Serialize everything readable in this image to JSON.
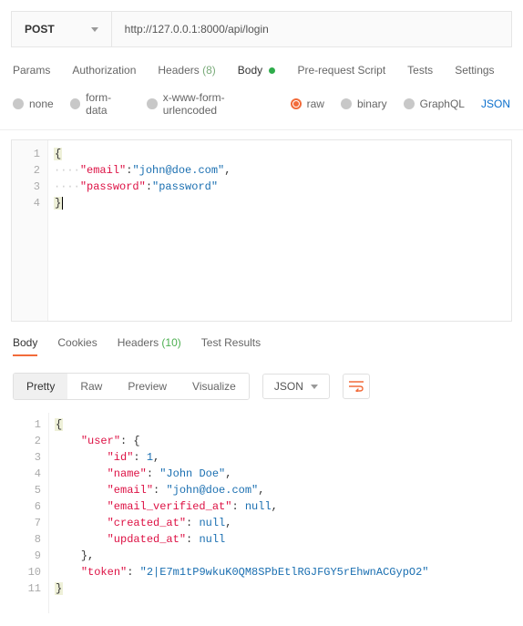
{
  "request": {
    "method": "POST",
    "url": "http://127.0.0.1:8000/api/login",
    "tabs": {
      "params": "Params",
      "authorization": "Authorization",
      "headers_label": "Headers",
      "headers_count": "(8)",
      "body": "Body",
      "prerequest": "Pre-request Script",
      "tests": "Tests",
      "settings": "Settings"
    },
    "body_types": {
      "none": "none",
      "form_data": "form-data",
      "urlencoded": "x-www-form-urlencoded",
      "raw": "raw",
      "binary": "binary",
      "graphql": "GraphQL",
      "json_link": "JSON"
    },
    "body_json": {
      "email_key": "\"email\"",
      "email_val": "\"john@doe.com\"",
      "password_key": "\"password\"",
      "password_val": "\"password\""
    }
  },
  "response": {
    "tabs": {
      "body": "Body",
      "cookies": "Cookies",
      "headers_label": "Headers",
      "headers_count": "(10)",
      "test_results": "Test Results"
    },
    "views": {
      "pretty": "Pretty",
      "raw": "Raw",
      "preview": "Preview",
      "visualize": "Visualize"
    },
    "format": "JSON",
    "body": {
      "user_key": "\"user\"",
      "id_key": "\"id\"",
      "id_val": "1",
      "name_key": "\"name\"",
      "name_val": "\"John Doe\"",
      "email_key": "\"email\"",
      "email_val": "\"john@doe.com\"",
      "ev_key": "\"email_verified_at\"",
      "null_val": "null",
      "created_key": "\"created_at\"",
      "updated_key": "\"updated_at\"",
      "token_key": "\"token\"",
      "token_val": "\"2|E7m1tP9wkuK0QM8SPbEtlRGJFGY5rEhwnACGypO2\""
    }
  }
}
